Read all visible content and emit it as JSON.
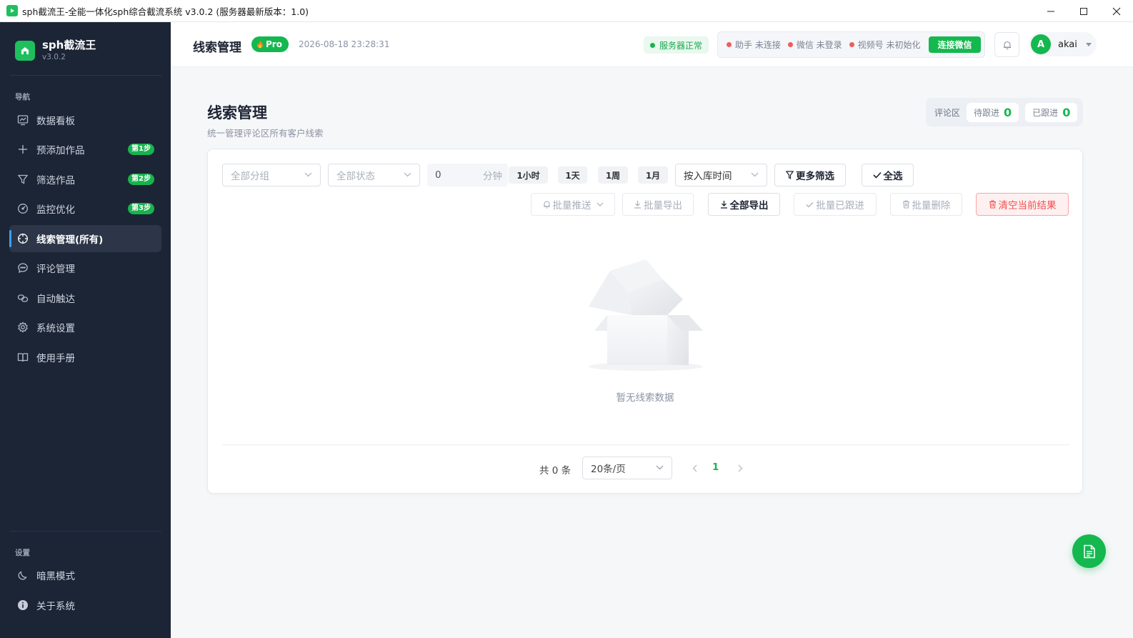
{
  "window": {
    "title": "sph截流王-全能一体化sph综合截流系统 v3.0.2 (服务器最新版本：1.0)"
  },
  "sidebar": {
    "brand_name": "sph截流王",
    "brand_version": "v3.0.2",
    "nav_section": "导航",
    "items": [
      {
        "label": "数据看板",
        "icon": "chart-board-icon"
      },
      {
        "label": "预添加作品",
        "icon": "plus-icon",
        "badge": "第1步"
      },
      {
        "label": "筛选作品",
        "icon": "filter-icon",
        "badge": "第2步"
      },
      {
        "label": "监控优化",
        "icon": "gauge-icon",
        "badge": "第3步"
      },
      {
        "label": "线索管理(所有)",
        "icon": "crosshair-icon",
        "active": true
      },
      {
        "label": "评论管理",
        "icon": "comment-icon"
      },
      {
        "label": "自动触达",
        "icon": "link-icon"
      },
      {
        "label": "系统设置",
        "icon": "gear-icon"
      },
      {
        "label": "使用手册",
        "icon": "book-icon"
      }
    ],
    "settings_section": "设置",
    "settings_items": [
      {
        "label": "暗黑模式",
        "icon": "moon-icon"
      },
      {
        "label": "关于系统",
        "icon": "info-icon"
      }
    ]
  },
  "header": {
    "title": "线索管理",
    "pro_label": "Pro",
    "datetime": "2026-08-18 23:28:31",
    "server_status": "服务器正常",
    "assistant_status": "助手 未连接",
    "wechat_status": "微信 未登录",
    "channels_status": "视频号 未初始化",
    "connect_button": "连接微信",
    "username": "akai",
    "avatar_letter": "A"
  },
  "main": {
    "page_title": "线索管理",
    "page_subtitle": "统一管理评论区所有客户线索",
    "stats_label": "评论区",
    "pending_label": "待跟进",
    "pending_count": "0",
    "followed_label": "已跟进",
    "followed_count": "0"
  },
  "filters": {
    "group_placeholder": "全部分组",
    "status_placeholder": "全部状态",
    "minutes_value": "0",
    "minutes_unit": "分钟",
    "quick_ranges": [
      "1小时",
      "1天",
      "1周",
      "1月"
    ],
    "sort_value": "按入库时间",
    "more_filters": "更多筛选",
    "select_all": "全选"
  },
  "actions": {
    "batch_push": "批量推送",
    "batch_export": "批量导出",
    "export_all": "全部导出",
    "batch_followed": "批量已跟进",
    "batch_delete": "批量删除",
    "clear_results": "清空当前结果"
  },
  "empty": {
    "text": "暂无线索数据"
  },
  "pagination": {
    "total": "共 0 条",
    "page_size": "20条/页",
    "current_page": "1"
  },
  "colors": {
    "accent": "#14b84f",
    "sidebar_bg": "#1c2536",
    "danger": "#f0504f"
  }
}
